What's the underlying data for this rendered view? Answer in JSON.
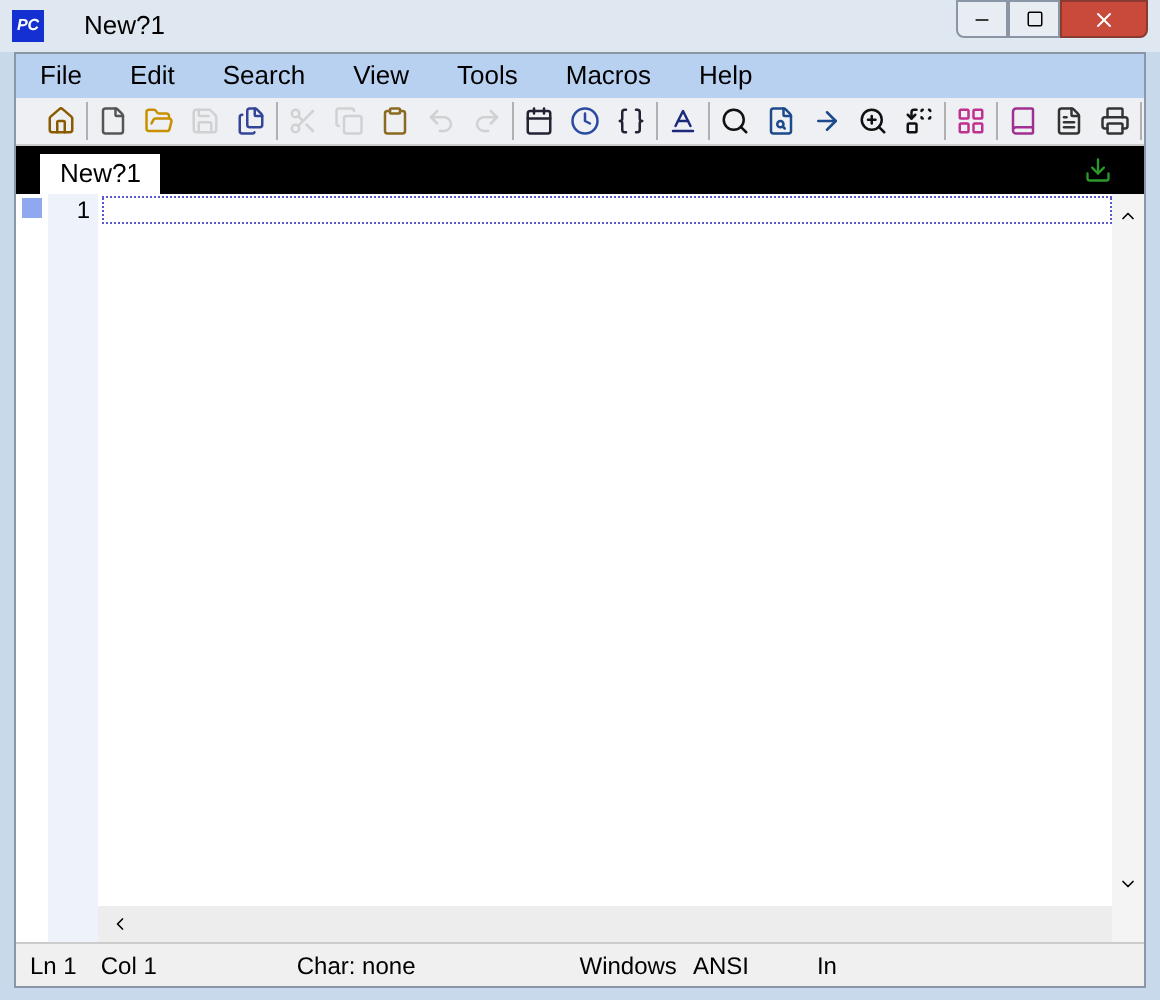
{
  "window": {
    "title": "New?1",
    "logo": "PC"
  },
  "menu": [
    "File",
    "Edit",
    "Search",
    "View",
    "Tools",
    "Macros",
    "Help"
  ],
  "toolbar": [
    [
      {
        "disabled": false
      }
    ],
    [
      {
        "disabled": false
      },
      {
        "disabled": false
      },
      {
        "disabled": true
      },
      {
        "disabled": false
      }
    ],
    [
      {
        "disabled": true
      },
      {
        "disabled": true
      },
      {
        "disabled": false
      },
      {
        "disabled": true
      },
      {
        "disabled": true
      }
    ],
    [
      {
        "disabled": false
      },
      {
        "disabled": false
      },
      {
        "disabled": false
      }
    ],
    [
      {
        "disabled": false
      }
    ],
    [
      {
        "disabled": false
      },
      {
        "disabled": false
      },
      {
        "disabled": false
      },
      {
        "disabled": false
      },
      {
        "disabled": false
      }
    ],
    [
      {
        "disabled": false
      }
    ],
    [
      {
        "disabled": false
      },
      {
        "disabled": false
      },
      {
        "disabled": false
      }
    ]
  ],
  "tabs": [
    {
      "label": "New?1",
      "selected": true
    }
  ],
  "editor": {
    "lines": [
      "1"
    ]
  },
  "status_bar": [
    "Ln 1",
    "Col 1",
    "Char: none",
    "Windows",
    "ANSI",
    "In"
  ]
}
